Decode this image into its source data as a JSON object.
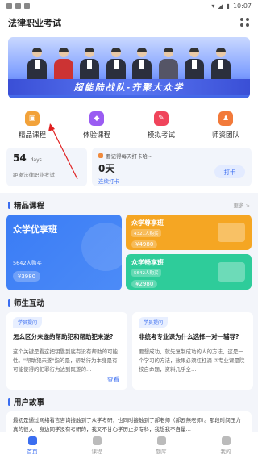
{
  "status": {
    "time": "10:07"
  },
  "header": {
    "title": "法律职业考试"
  },
  "banner": {
    "slogan": "超能陆战队-齐聚大众学"
  },
  "quick_nav": [
    {
      "label": "精品课程",
      "color": "#f2a23a"
    },
    {
      "label": "体验课程",
      "color": "#9a5cf2"
    },
    {
      "label": "模拟考试",
      "color": "#f0445b"
    },
    {
      "label": "师资团队",
      "color": "#f27a3a"
    }
  ],
  "countdown": {
    "days": "54",
    "unit": "days",
    "subtitle": "距离法律职业考试"
  },
  "checkin": {
    "reminder": "要记得每天打卡哈~",
    "days": "0天",
    "action_text": "连续打卡",
    "button": "打卡"
  },
  "courses": {
    "title": "精品课程",
    "more": "更多 >",
    "featured": {
      "title": "众学优享班",
      "count": "5642人购买",
      "price": "¥3980"
    },
    "items": [
      {
        "title": "众学尊享班",
        "count": "4321人购买",
        "price": "¥4980",
        "color": "#f5a623"
      },
      {
        "title": "众学畅享班",
        "count": "5642人购买",
        "price": "¥2980",
        "color": "#2ecc9a"
      }
    ]
  },
  "interaction": {
    "title": "师生互动",
    "items": [
      {
        "tag": "学员提问",
        "question": "怎么区分未遂的帮助犯和帮助犯未遂?",
        "answer": "这个关键是看这把钥匙到底有没有帮助的可能性。\"帮助犯未遂\"指的是，帮助行为本身是有可能使得的犯罪行为达到既遂的…",
        "link": "查看"
      },
      {
        "tag": "学员提问",
        "question": "非统考专业课为什么选择一对一辅导?",
        "answer": "要想成功，就先复制成功的人的方法，这是一个学习的方法，效果必须杠杠滴 ②专业课是院校自命题，资料几乎全…",
        "link": "查看"
      }
    ]
  },
  "story": {
    "title": "用户故事",
    "text": "最初是通过网络看言咨询接触到了众学考研，也同时接触到了郝老师（郝云燕老师）。那段时间压力真的很大，身边同学没有考研的，我又不甘心学历止步专科，我想我不自量…"
  },
  "tabbar": [
    {
      "label": "首页",
      "active": true
    },
    {
      "label": "课程",
      "active": false
    },
    {
      "label": "题库",
      "active": false
    },
    {
      "label": "我的",
      "active": false
    }
  ]
}
